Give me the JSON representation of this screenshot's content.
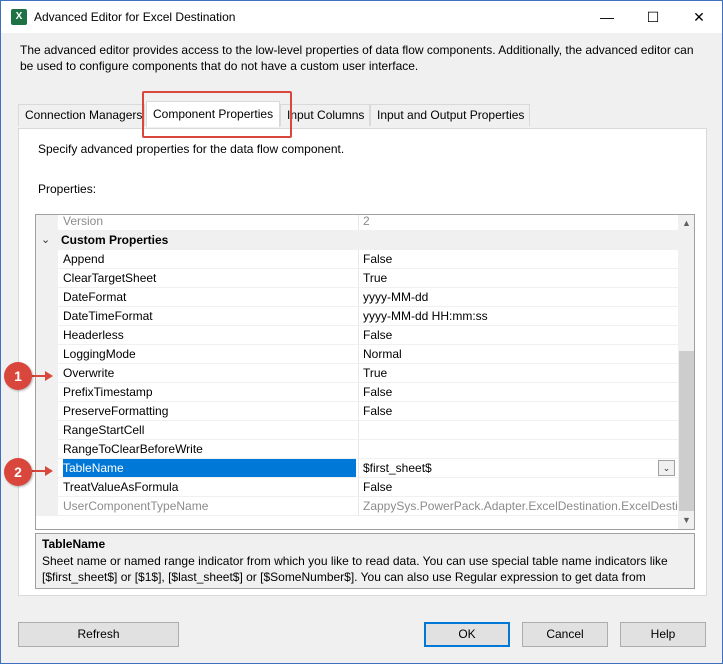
{
  "window": {
    "title": "Advanced Editor for Excel Destination",
    "app_icon": "excel-icon",
    "app_icon_glyph": "X",
    "controls": {
      "minimize": "—",
      "maximize": "☐",
      "close": "✕"
    }
  },
  "description": "The advanced editor provides access to the low-level properties of data flow components. Additionally, the advanced editor can be used to configure components that do not have a custom user interface.",
  "tabs": [
    {
      "label": "Connection Managers",
      "active": false
    },
    {
      "label": "Component Properties",
      "active": true
    },
    {
      "label": "Input Columns",
      "active": false
    },
    {
      "label": "Input and Output Properties",
      "active": false
    }
  ],
  "panel": {
    "spec_text": "Specify advanced properties for the data flow component.",
    "properties_label": "Properties:"
  },
  "grid": {
    "rows": [
      {
        "name": "Version",
        "value": "2",
        "readonly": true
      },
      {
        "name": "Custom Properties",
        "value": "",
        "category": true,
        "collapse_glyph": "⌄"
      },
      {
        "name": "Append",
        "value": "False"
      },
      {
        "name": "ClearTargetSheet",
        "value": "True"
      },
      {
        "name": "DateFormat",
        "value": "yyyy-MM-dd"
      },
      {
        "name": "DateTimeFormat",
        "value": "yyyy-MM-dd HH:mm:ss"
      },
      {
        "name": "Headerless",
        "value": "False"
      },
      {
        "name": "LoggingMode",
        "value": "Normal"
      },
      {
        "name": "Overwrite",
        "value": "True"
      },
      {
        "name": "PrefixTimestamp",
        "value": "False"
      },
      {
        "name": "PreserveFormatting",
        "value": "False"
      },
      {
        "name": "RangeStartCell",
        "value": ""
      },
      {
        "name": "RangeToClearBeforeWrite",
        "value": ""
      },
      {
        "name": "TableName",
        "value": "$first_sheet$",
        "selected": true,
        "dropdown_glyph": "⌄"
      },
      {
        "name": "TreatValueAsFormula",
        "value": "False"
      },
      {
        "name": "UserComponentTypeName",
        "value": "ZappySys.PowerPack.Adapter.ExcelDestination.ExcelDestinat",
        "readonly": true
      }
    ],
    "scroll_up_glyph": "▲",
    "scroll_down_glyph": "▼"
  },
  "description_box": {
    "title": "TableName",
    "text": "Sheet name or named range indicator from which you like to read data. You can use special table name indicators like [$first_sheet$] or [$1$], [$last_sheet$] or [$SomeNumber$]. You can also use Regular expression to get data from multiple ..."
  },
  "callouts": [
    {
      "label": "1",
      "target": "Overwrite"
    },
    {
      "label": "2",
      "target": "TableName"
    }
  ],
  "buttons": {
    "refresh": "Refresh",
    "ok": "OK",
    "cancel": "Cancel",
    "help": "Help"
  },
  "colors": {
    "selection": "#0078d7",
    "callout": "#d9463c",
    "window_border": "#3f6fbf"
  }
}
